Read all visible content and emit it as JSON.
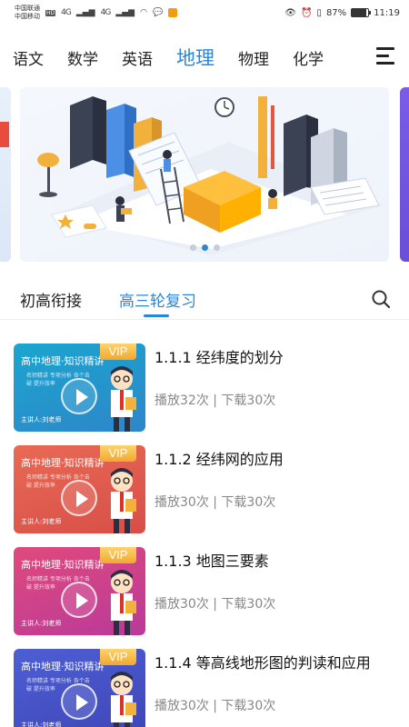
{
  "status_bar": {
    "carrier_1": "中国联通",
    "carrier_2": "中国移动",
    "network": "4G",
    "battery": "87%",
    "battery_level": 0.87,
    "time": "11:19"
  },
  "subject_tabs": [
    "语文",
    "数学",
    "英语",
    "地理",
    "物理",
    "化学"
  ],
  "subject_active_index": 3,
  "level_tabs": [
    "初高衔接",
    "高三轮复习"
  ],
  "level_active_index": 1,
  "banner": {
    "slide_count": 3,
    "active_slide": 1
  },
  "courses": [
    {
      "title": "1.1.1 经纬度的划分",
      "stats": "播放32次 | 下载30次",
      "thumb_title": "高中地理·知识精讲",
      "thumb_sub": "名师精讲 专项分析 各个击破 提升效率",
      "teacher": "主讲人:刘老师",
      "vip": "VIP",
      "colors": [
        "#1aa6cf",
        "#2e86c9"
      ]
    },
    {
      "title": "1.1.2 经纬网的应用",
      "stats": "播放30次 | 下载30次",
      "thumb_title": "高中地理·知识精讲",
      "thumb_sub": "名师精讲 专项分析 各个击破 提升效率",
      "teacher": "主讲人:刘老师",
      "vip": "VIP",
      "colors": [
        "#e86a55",
        "#d84e48"
      ]
    },
    {
      "title": "1.1.3 地图三要素",
      "stats": "播放30次 | 下载30次",
      "thumb_title": "高中地理·知识精讲",
      "thumb_sub": "名师精讲 专项分析 各个击破 提升效率",
      "teacher": "主讲人:刘老师",
      "vip": "VIP",
      "colors": [
        "#e04a7c",
        "#b9399a"
      ]
    },
    {
      "title": "1.1.4 等高线地形图的判读和应用",
      "stats": "播放30次 | 下载30次",
      "thumb_title": "高中地理·知识精讲",
      "thumb_sub": "名师精讲 专项分析 各个击破 提升效率",
      "teacher": "主讲人:刘老师",
      "vip": "VIP",
      "colors": [
        "#4d5fd4",
        "#3f46b6"
      ]
    }
  ]
}
